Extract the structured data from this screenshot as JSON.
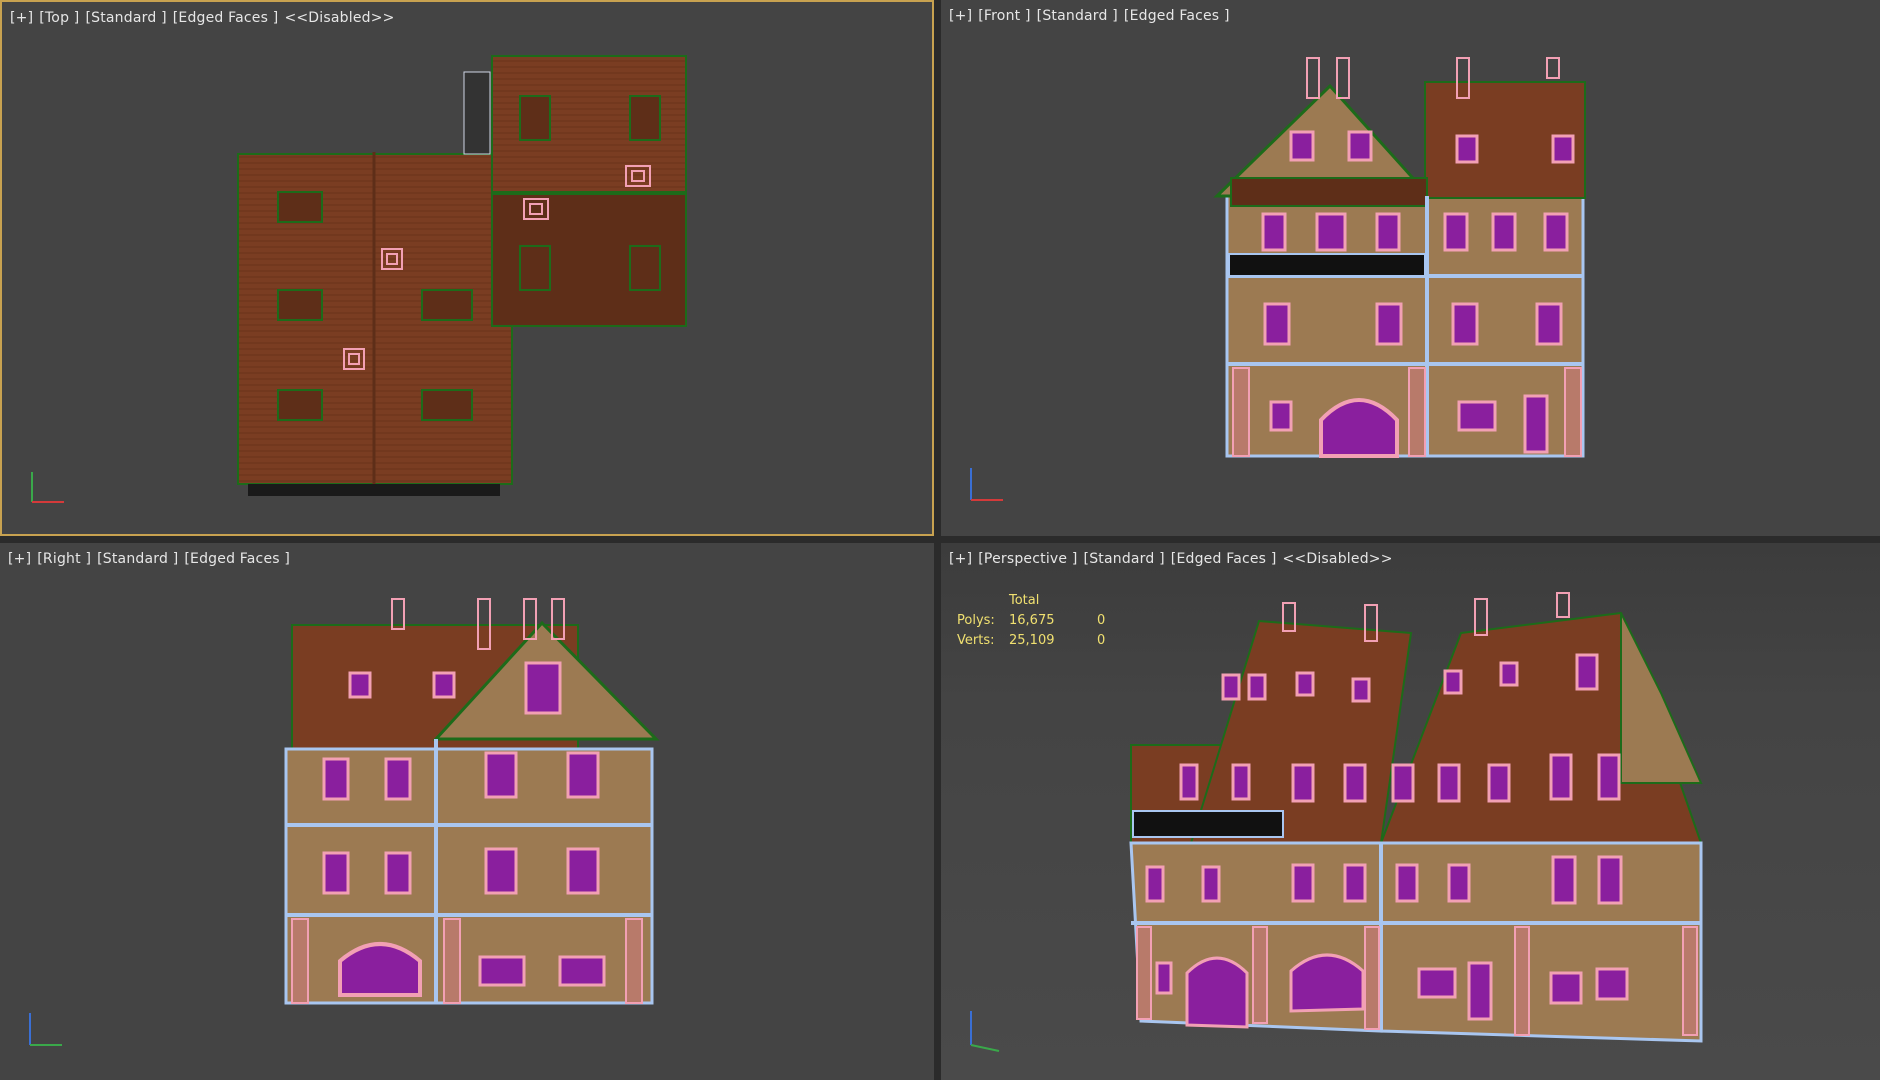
{
  "viewports": {
    "top": {
      "label": {
        "plus": "[+]",
        "view": "[Top ]",
        "shading": "[Standard ]",
        "edges": "[Edged Faces ]",
        "extra": "<<Disabled>>"
      },
      "axes": {
        "a": "y",
        "b": "x"
      }
    },
    "front": {
      "label": {
        "plus": "[+]",
        "view": "[Front ]",
        "shading": "[Standard ]",
        "edges": "[Edged Faces ]"
      },
      "axes": {
        "a": "z",
        "b": "x"
      }
    },
    "right": {
      "label": {
        "plus": "[+]",
        "view": "[Right ]",
        "shading": "[Standard ]",
        "edges": "[Edged Faces ]"
      },
      "axes": {
        "a": "z",
        "b": "y"
      }
    },
    "perspective": {
      "label": {
        "plus": "[+]",
        "view": "[Perspective ]",
        "shading": "[Standard ]",
        "edges": "[Edged Faces ]",
        "extra": "<<Disabled>>"
      },
      "axes": {
        "a": "z"
      },
      "stats": {
        "header": "Total",
        "polys_label": "Polys:",
        "polys_total": "16,675",
        "polys_sel": "0",
        "verts_label": "Verts:",
        "verts_total": "25,109",
        "verts_sel": "0"
      }
    }
  },
  "colors": {
    "roof": "#7a3d22",
    "roof_dark": "#5e2e18",
    "wall": "#9c7a52",
    "timber": "#a9c6f0",
    "window": "#8a1f9e",
    "window_frame": "#f2a0b4",
    "outline": "#1d6b1a",
    "active_border": "#c8a250",
    "stats_text": "#f0e070"
  }
}
